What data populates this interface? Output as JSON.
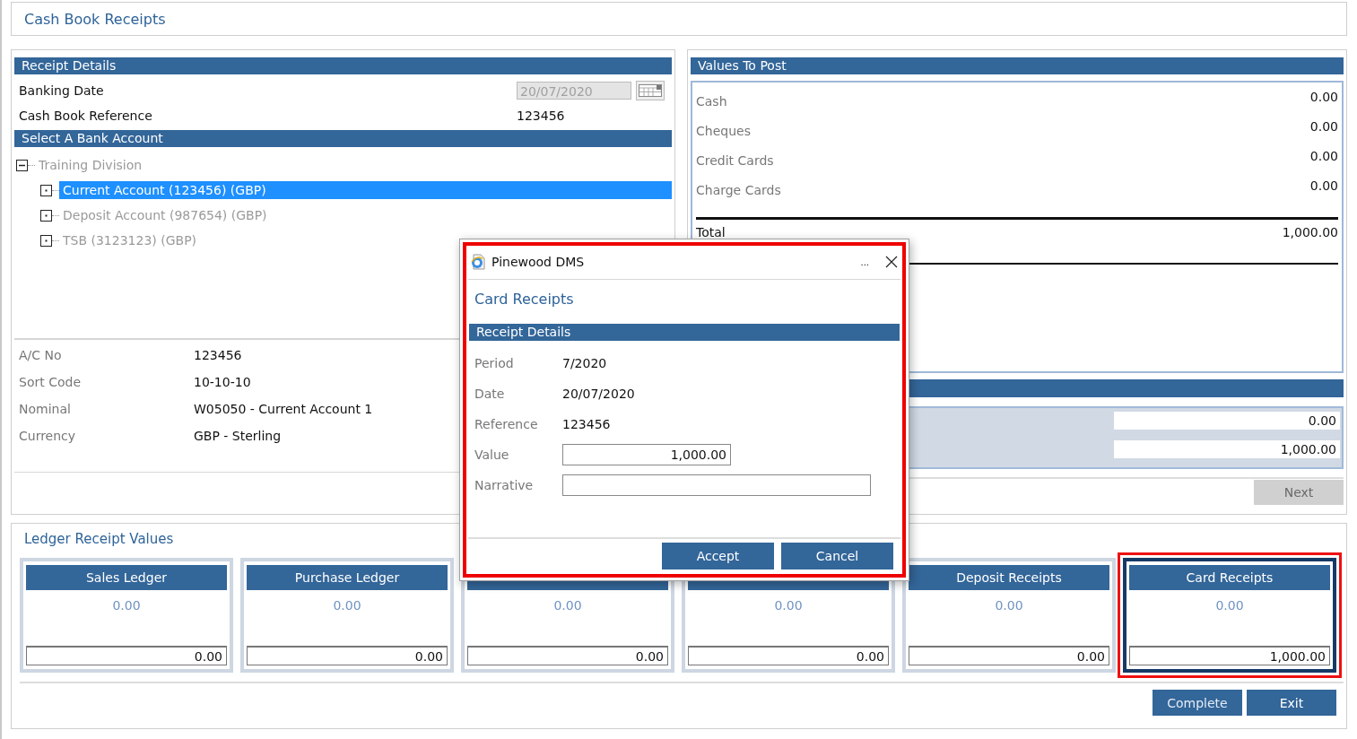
{
  "page_title": "Cash Book Receipts",
  "receipt_details": {
    "title": "Receipt Details",
    "fields": [
      {
        "label": "Banking Date",
        "kind": "date",
        "value": "20/07/2020",
        "disabled": true
      },
      {
        "label": "Cash Book Reference",
        "kind": "text",
        "value": "123456"
      }
    ]
  },
  "bank_account": {
    "title": "Select A Bank Account",
    "tree": [
      {
        "label": "Training Division",
        "expanded": true,
        "selected": false,
        "children": [
          {
            "label": "Current Account (123456) (GBP)",
            "expanded": false,
            "selected": true
          },
          {
            "label": "Deposit Account (987654) (GBP)",
            "expanded": false,
            "selected": false
          },
          {
            "label": "TSB (3123123) (GBP)",
            "expanded": false,
            "selected": false
          }
        ]
      }
    ]
  },
  "account_details": [
    {
      "label": "A/C No",
      "value": "123456"
    },
    {
      "label": "Sort Code",
      "value": "10-10-10"
    },
    {
      "label": "Nominal",
      "value": "W05050 - Current Account 1"
    },
    {
      "label": "Currency",
      "value": "GBP - Sterling"
    }
  ],
  "values_to_post": {
    "title": "Values To Post",
    "rows": [
      {
        "label": "Cash",
        "value": "0.00"
      },
      {
        "label": "Cheques",
        "value": "0.00"
      },
      {
        "label": "Credit Cards",
        "value": "0.00"
      },
      {
        "label": "Charge Cards",
        "value": "0.00"
      }
    ],
    "total": {
      "label": "Total",
      "value": "1,000.00"
    }
  },
  "summary": {
    "values": [
      "0.00",
      "1,000.00"
    ]
  },
  "next_button": {
    "label": "Next",
    "disabled": true
  },
  "ledger": {
    "title": "Ledger Receipt Values",
    "cards": [
      {
        "title": "Sales Ledger",
        "balance": "0.00",
        "value": "0.00",
        "selected": false,
        "highlighted": false
      },
      {
        "title": "Purchase Ledger",
        "balance": "0.00",
        "value": "0.00",
        "selected": false,
        "highlighted": false
      },
      {
        "balance": "0.00",
        "value": "0.00",
        "selected": false,
        "highlighted": false
      },
      {
        "balance": "0.00",
        "value": "0.00",
        "selected": false,
        "highlighted": false
      },
      {
        "title": "Deposit Receipts",
        "balance": "0.00",
        "value": "0.00",
        "selected": false,
        "highlighted": false
      },
      {
        "title": "Card Receipts",
        "balance": "0.00",
        "value": "1,000.00",
        "selected": true,
        "highlighted": true
      }
    ]
  },
  "buttons": [
    {
      "label": "Complete"
    },
    {
      "label": "Exit"
    }
  ],
  "dialog": {
    "title": "Pinewood DMS",
    "menu": "...",
    "highlighted": true,
    "heading": "Card Receipts",
    "section": "Receipt Details",
    "fields": [
      {
        "label": "Period",
        "kind": "text",
        "value": "7/2020"
      },
      {
        "label": "Date",
        "kind": "text",
        "value": "20/07/2020"
      },
      {
        "label": "Reference",
        "kind": "text",
        "value": "123456"
      },
      {
        "label": "Value",
        "kind": "short-input",
        "value": "1,000.00"
      },
      {
        "label": "Narrative",
        "kind": "long-input"
      }
    ],
    "buttons": [
      {
        "label": "Accept"
      },
      {
        "label": "Cancel"
      }
    ]
  }
}
